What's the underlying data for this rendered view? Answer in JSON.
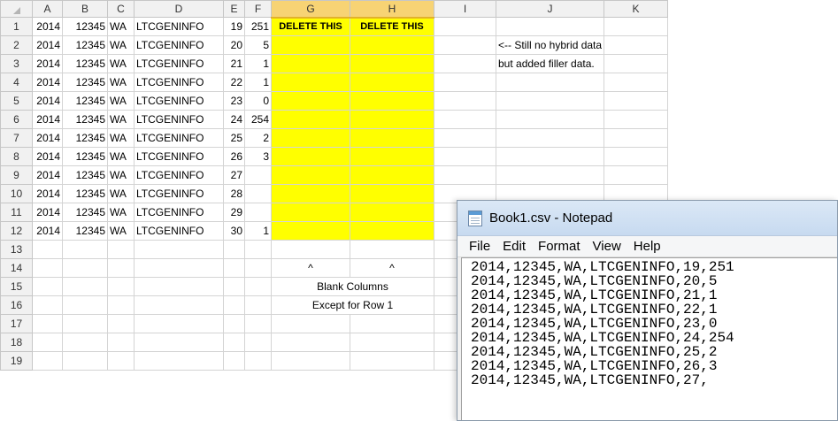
{
  "sheet": {
    "columns": [
      "A",
      "B",
      "C",
      "D",
      "E",
      "F",
      "G",
      "H",
      "I",
      "J",
      "K"
    ],
    "selected_columns": [
      "G",
      "H"
    ],
    "rows": [
      {
        "num": "1",
        "A": "2014",
        "B": "12345",
        "C": "WA",
        "D": "LTCGENINFO",
        "E": "19",
        "F": "251",
        "G": "DELETE THIS",
        "H": "DELETE THIS",
        "I": "",
        "J": "",
        "K": ""
      },
      {
        "num": "2",
        "A": "2014",
        "B": "12345",
        "C": "WA",
        "D": "LTCGENINFO",
        "E": "20",
        "F": "5",
        "G": "",
        "H": "",
        "I": "",
        "J": "<-- Still no hybrid data",
        "K": ""
      },
      {
        "num": "3",
        "A": "2014",
        "B": "12345",
        "C": "WA",
        "D": "LTCGENINFO",
        "E": "21",
        "F": "1",
        "G": "",
        "H": "",
        "I": "",
        "J": "but added filler data.",
        "K": ""
      },
      {
        "num": "4",
        "A": "2014",
        "B": "12345",
        "C": "WA",
        "D": "LTCGENINFO",
        "E": "22",
        "F": "1",
        "G": "",
        "H": "",
        "I": "",
        "J": "",
        "K": ""
      },
      {
        "num": "5",
        "A": "2014",
        "B": "12345",
        "C": "WA",
        "D": "LTCGENINFO",
        "E": "23",
        "F": "0",
        "G": "",
        "H": "",
        "I": "",
        "J": "",
        "K": ""
      },
      {
        "num": "6",
        "A": "2014",
        "B": "12345",
        "C": "WA",
        "D": "LTCGENINFO",
        "E": "24",
        "F": "254",
        "G": "",
        "H": "",
        "I": "",
        "J": "",
        "K": ""
      },
      {
        "num": "7",
        "A": "2014",
        "B": "12345",
        "C": "WA",
        "D": "LTCGENINFO",
        "E": "25",
        "F": "2",
        "G": "",
        "H": "",
        "I": "",
        "J": "",
        "K": ""
      },
      {
        "num": "8",
        "A": "2014",
        "B": "12345",
        "C": "WA",
        "D": "LTCGENINFO",
        "E": "26",
        "F": "3",
        "G": "",
        "H": "",
        "I": "",
        "J": "",
        "K": ""
      },
      {
        "num": "9",
        "A": "2014",
        "B": "12345",
        "C": "WA",
        "D": "LTCGENINFO",
        "E": "27",
        "F": "",
        "G": "",
        "H": "",
        "I": "",
        "J": "",
        "K": ""
      },
      {
        "num": "10",
        "A": "2014",
        "B": "12345",
        "C": "WA",
        "D": "LTCGENINFO",
        "E": "28",
        "F": "",
        "G": "",
        "H": "",
        "I": "",
        "J": "",
        "K": ""
      },
      {
        "num": "11",
        "A": "2014",
        "B": "12345",
        "C": "WA",
        "D": "LTCGENINFO",
        "E": "29",
        "F": "",
        "G": "",
        "H": "",
        "I": "",
        "J": "",
        "K": ""
      },
      {
        "num": "12",
        "A": "2014",
        "B": "12345",
        "C": "WA",
        "D": "LTCGENINFO",
        "E": "30",
        "F": "1",
        "G": "",
        "H": "",
        "I": "",
        "J": "",
        "K": ""
      },
      {
        "num": "13",
        "A": "",
        "B": "",
        "C": "",
        "D": "",
        "E": "",
        "F": "",
        "G": "",
        "H": "",
        "I": "",
        "J": "",
        "K": ""
      },
      {
        "num": "14",
        "A": "",
        "B": "",
        "C": "",
        "D": "",
        "E": "",
        "F": "",
        "G": "^",
        "H": "^",
        "I": "",
        "J": "",
        "K": ""
      },
      {
        "num": "15",
        "A": "",
        "B": "",
        "C": "",
        "D": "",
        "E": "",
        "F": "",
        "G": "Blank Columns",
        "H": "",
        "I": "",
        "J": "",
        "K": ""
      },
      {
        "num": "16",
        "A": "",
        "B": "",
        "C": "",
        "D": "",
        "E": "",
        "F": "",
        "G": "Except for Row 1",
        "H": "",
        "I": "",
        "J": "",
        "K": ""
      },
      {
        "num": "17",
        "A": "",
        "B": "",
        "C": "",
        "D": "",
        "E": "",
        "F": "",
        "G": "",
        "H": "",
        "I": "",
        "J": "",
        "K": ""
      },
      {
        "num": "18",
        "A": "",
        "B": "",
        "C": "",
        "D": "",
        "E": "",
        "F": "",
        "G": "",
        "H": "",
        "I": "",
        "J": "",
        "K": ""
      },
      {
        "num": "19",
        "A": "",
        "B": "",
        "C": "",
        "D": "",
        "E": "",
        "F": "",
        "G": "",
        "H": "",
        "I": "",
        "J": "",
        "K": ""
      }
    ]
  },
  "notepad": {
    "title": "Book1.csv - Notepad",
    "menu": [
      "File",
      "Edit",
      "Format",
      "View",
      "Help"
    ],
    "lines": [
      "2014,12345,WA,LTCGENINFO,19,251",
      "2014,12345,WA,LTCGENINFO,20,5",
      "2014,12345,WA,LTCGENINFO,21,1",
      "2014,12345,WA,LTCGENINFO,22,1",
      "2014,12345,WA,LTCGENINFO,23,0",
      "2014,12345,WA,LTCGENINFO,24,254",
      "2014,12345,WA,LTCGENINFO,25,2",
      "2014,12345,WA,LTCGENINFO,26,3",
      "2014,12345,WA,LTCGENINFO,27,"
    ]
  },
  "colors": {
    "highlight": "#ffff00",
    "selected_header": "#f7d374"
  }
}
